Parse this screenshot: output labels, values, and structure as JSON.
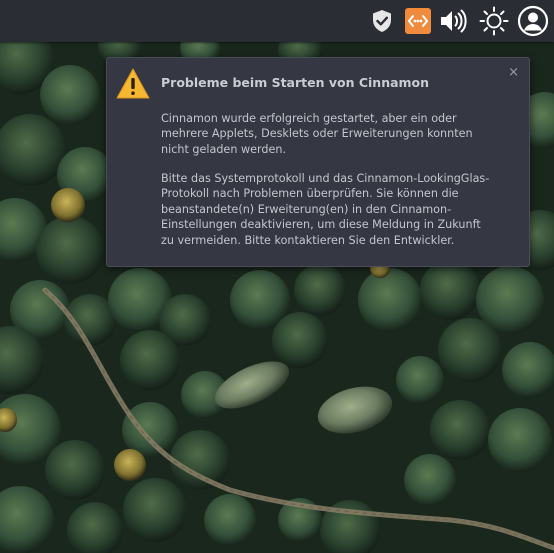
{
  "panel": {
    "tray_icons": [
      "shield-check-icon",
      "network-proxy-icon",
      "volume-icon",
      "brightness-icon",
      "user-account-icon"
    ],
    "accent_color": "#f08a3c",
    "background": "#2b2d35"
  },
  "notification": {
    "icon": "warning-triangle-icon",
    "title": "Probleme beim Starten von Cinnamon",
    "close_label": "×",
    "paragraph_1": "Cinnamon wurde erfolgreich gestartet, aber ein oder\nmehrere Applets, Desklets oder Erweiterungen konnten\nnicht geladen werden.",
    "paragraph_2": "Bitte das Systemprotokoll und das Cinnamon-LookingGlas-\nProtokoll nach Problemen überprüfen.  Sie können die\nbeanstandete(n) Erweiterung(en) in den Cinnamon-\nEinstellungen deaktivieren, um diese Meldung in Zukunft\nzu vermeiden.  Bitte kontaktieren Sie den Entwickler."
  },
  "desktop": {
    "wallpaper": "aerial-forest-wallpaper"
  }
}
